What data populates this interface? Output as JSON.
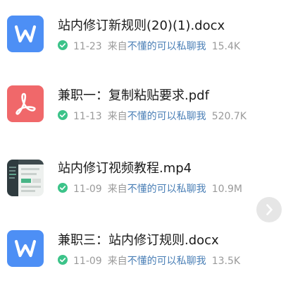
{
  "files": [
    {
      "name": "站内修订新规则(20)(1).docx",
      "type": "word",
      "icon": "word-doc-icon",
      "date": "11-23",
      "source_prefix": "来自",
      "owner": "不懂的可以私聊我",
      "size": "15.4K"
    },
    {
      "name": "兼职一：复制粘贴要求.pdf",
      "type": "pdf",
      "icon": "pdf-icon",
      "date": "11-13",
      "source_prefix": "来自",
      "owner": "不懂的可以私聊我",
      "size": "520.7K"
    },
    {
      "name": "站内修订视频教程.mp4",
      "type": "video",
      "icon": "video-thumbnail-icon",
      "date": "11-09",
      "source_prefix": "来自",
      "owner": "不懂的可以私聊我",
      "size": "10.9M"
    },
    {
      "name": "兼职三：站内修订规则.docx",
      "type": "word",
      "icon": "word-doc-icon",
      "date": "11-09",
      "source_prefix": "来自",
      "owner": "不懂的可以私聊我",
      "size": "13.5K"
    }
  ],
  "colors": {
    "word": "#4d8ff5",
    "pdf": "#f0686a",
    "check": "#3cc389",
    "owner_link": "#4a7fb6"
  },
  "scroll_button_icon": "chevron-right-icon"
}
